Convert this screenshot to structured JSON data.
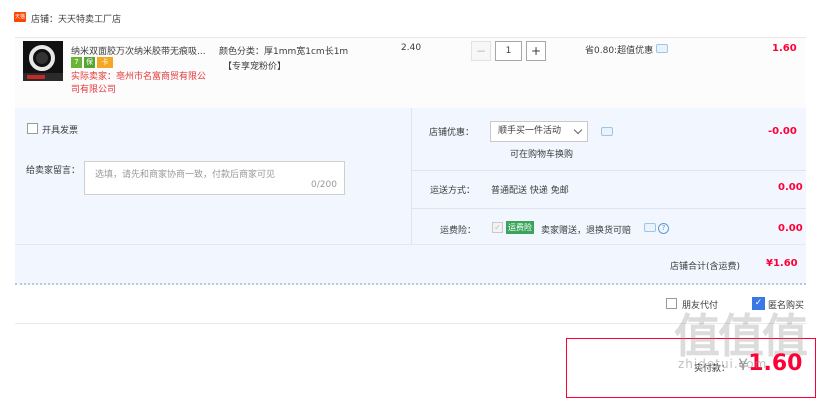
{
  "shop": {
    "icon_text": "天猫",
    "label": "店铺：天天特卖工厂店"
  },
  "item": {
    "title": "纳米双面胶万次纳米胶带无痕吸...",
    "sku_line1": "颜色分类：厚1mm宽1cm长1m",
    "sku_line2": "【专享宠粉价】",
    "seller_label": "实际卖家：",
    "seller_line1": "亳州市名富商贸有限公",
    "seller_line2": "司有限公司",
    "price": "2.40",
    "quantity": "1",
    "minus": "−",
    "plus": "+",
    "discount": "省0.80:超值优惠",
    "subtotal": "1.60",
    "badges": [
      "7",
      "保",
      "卡"
    ]
  },
  "options": {
    "invoice_label": "开具发票",
    "message_label": "给卖家留言：",
    "message_placeholder": "选填，请先和商家协商一致，付款后商家可见",
    "message_count": "0/200",
    "promo_label": "店铺优惠：",
    "promo_selected": "顺手买一件活动",
    "promo_hint": "可在购物车换购",
    "promo_value": "-0.00",
    "shipping_label": "运送方式：",
    "shipping_value": "普通配送 快递 免邮",
    "shipping_amount": "0.00",
    "insurance_label": "运费险：",
    "insurance_tag": "运费险",
    "insurance_desc": "卖家赠送，退换货可赔",
    "insurance_amount": "0.00"
  },
  "shop_total": {
    "label": "店铺合计(含运费)",
    "value": "¥1.60"
  },
  "bottom": {
    "friend_pay_label": "朋友代付",
    "anonymous_label": "匿名购买",
    "pay_label": "实付款：",
    "pay_currency": "¥",
    "pay_value": "1.60"
  },
  "watermark": {
    "big": "值值值",
    "small": "zhidetui.com"
  },
  "colors": {
    "accent": "#ff0036",
    "panel": "#f2f7ff",
    "brand": "#ff4400",
    "check": "#3b78e7"
  }
}
